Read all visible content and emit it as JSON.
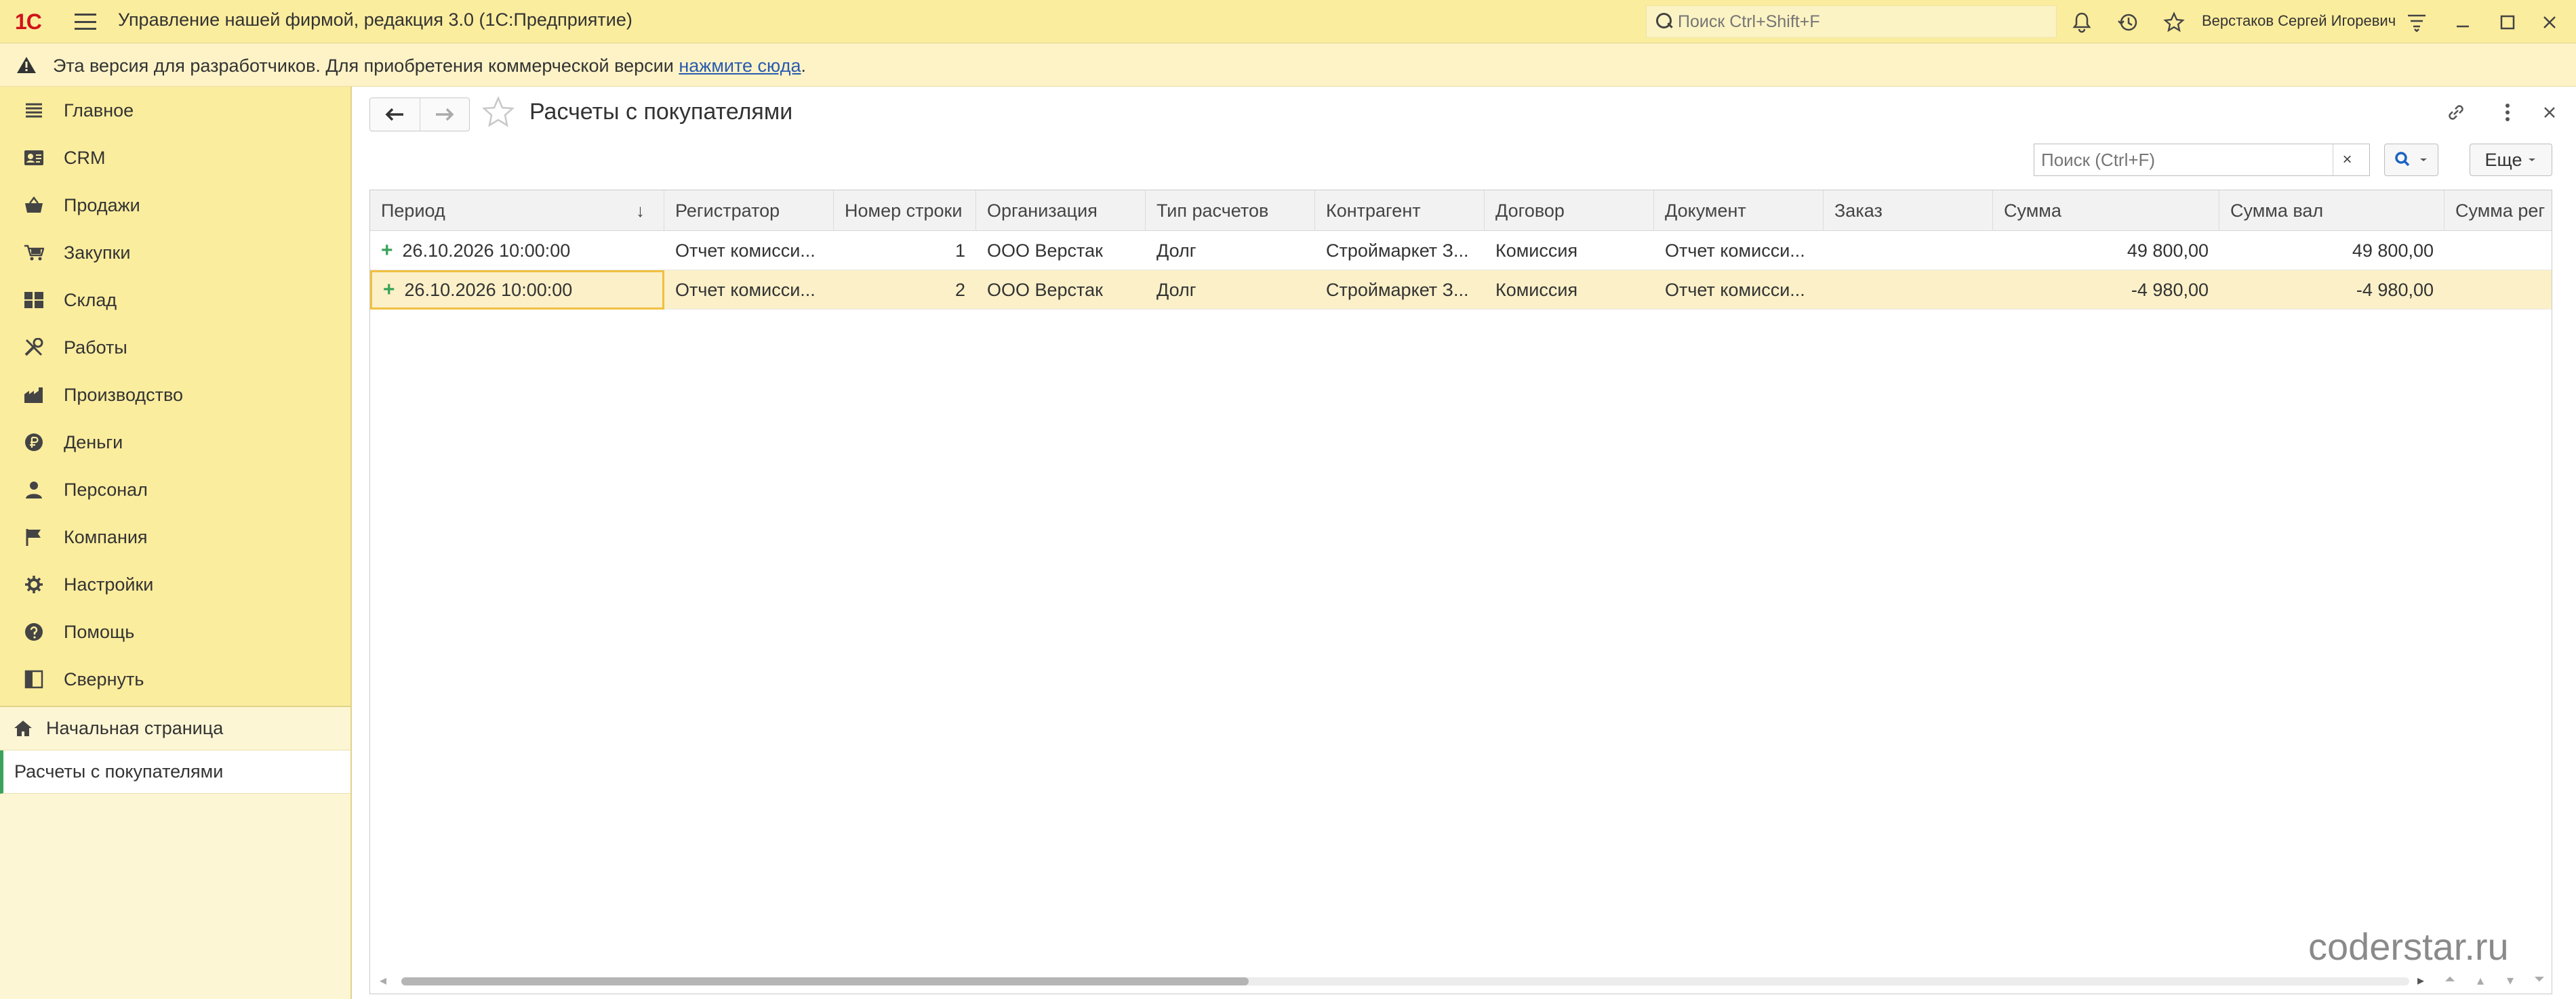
{
  "app": {
    "logo_text": "1C",
    "title": "Управление нашей фирмой, редакция 3.0  (1С:Предприятие)",
    "search_placeholder": "Поиск Ctrl+Shift+F",
    "user": "Верстаков Сергей Игоревич"
  },
  "warning": {
    "text": "Эта версия для разработчиков. Для приобретения коммерческой версии ",
    "link": "нажмите сюда",
    "suffix": "."
  },
  "sidebar": {
    "items": [
      {
        "label": "Главное",
        "icon": "list-icon"
      },
      {
        "label": "CRM",
        "icon": "contact-card-icon"
      },
      {
        "label": "Продажи",
        "icon": "shopping-basket-icon"
      },
      {
        "label": "Закупки",
        "icon": "purchases-icon"
      },
      {
        "label": "Склад",
        "icon": "warehouse-icon"
      },
      {
        "label": "Работы",
        "icon": "tools-icon"
      },
      {
        "label": "Производство",
        "icon": "factory-icon"
      },
      {
        "label": "Деньги",
        "icon": "ruble-icon"
      },
      {
        "label": "Персонал",
        "icon": "person-icon"
      },
      {
        "label": "Компания",
        "icon": "flag-icon"
      },
      {
        "label": "Настройки",
        "icon": "gear-icon"
      },
      {
        "label": "Помощь",
        "icon": "help-icon"
      },
      {
        "label": "Свернуть",
        "icon": "collapse-icon"
      }
    ],
    "home": "Начальная страница",
    "open_form": "Расчеты с покупателями"
  },
  "form": {
    "title": "Расчеты с покупателями",
    "search_placeholder": "Поиск (Ctrl+F)",
    "clear_label": "×",
    "more_label": "Еще",
    "columns": [
      "Период",
      "Регистратор",
      "Номер строки",
      "Организация",
      "Тип расчетов",
      "Контрагент",
      "Договор",
      "Документ",
      "Заказ",
      "Сумма",
      "Сумма вал",
      "Сумма рег"
    ],
    "rows": [
      [
        "26.10.2026 10:00:00",
        "Отчет комисси...",
        "1",
        "ООО Верстак",
        "Долг",
        "Строймаркет З...",
        "Комиссия",
        "Отчет комисси...",
        "",
        "49 800,00",
        "49 800,00",
        ""
      ],
      [
        "26.10.2026 10:00:00",
        "Отчет комисси...",
        "2",
        "ООО Верстак",
        "Долг",
        "Строймаркет З...",
        "Комиссия",
        "Отчет комисси...",
        "",
        "-4 980,00",
        "-4 980,00",
        ""
      ]
    ],
    "sort_indicator": "↓"
  },
  "watermark": "coderstar.ru",
  "colors": {
    "panel": "#fbed9e",
    "selection": "#fbf0c8",
    "accent_red": "#d0131b",
    "accent_green": "#3aa35a",
    "link": "#2a5bb0"
  }
}
